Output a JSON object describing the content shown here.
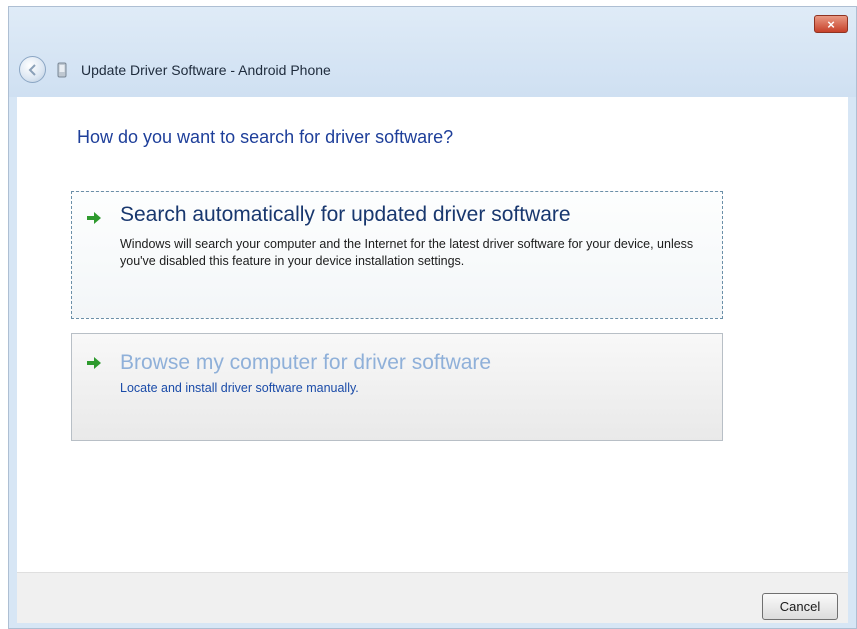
{
  "window": {
    "title": "Update Driver Software - Android Phone",
    "close_label": "×"
  },
  "main": {
    "heading": "How do you want to search for driver software?"
  },
  "options": [
    {
      "title": "Search automatically for updated driver software",
      "description": "Windows will search your computer and the Internet for the latest driver software for your device, unless you've disabled this feature in your device installation settings.",
      "icon": "green-arrow-icon"
    },
    {
      "title": "Browse my computer for driver software",
      "description": "Locate and install driver software manually.",
      "icon": "green-arrow-icon"
    }
  ],
  "footer": {
    "cancel_label": "Cancel"
  },
  "colors": {
    "heading": "#1e3f9a",
    "arrow": "#2e9a2e",
    "link_blue": "#1a4ba8"
  }
}
